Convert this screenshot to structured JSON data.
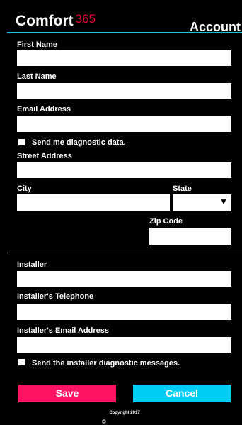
{
  "header": {
    "brand_name": "Comfort",
    "brand_number": "365",
    "title": "Account"
  },
  "fields": {
    "first_name": {
      "label": "First Name",
      "value": ""
    },
    "last_name": {
      "label": "Last Name",
      "value": ""
    },
    "email": {
      "label": "Email Address",
      "value": ""
    },
    "street": {
      "label": "Street Address",
      "value": ""
    },
    "city": {
      "label": "City",
      "value": ""
    },
    "state": {
      "label": "State",
      "value": ""
    },
    "zip": {
      "label": "Zip Code",
      "value": ""
    },
    "installer": {
      "label": "Installer",
      "value": ""
    },
    "installer_phone": {
      "label": "Installer's Telephone",
      "value": ""
    },
    "installer_email": {
      "label": "Installer's Email Address",
      "value": ""
    }
  },
  "checkboxes": {
    "diagnostic_data": {
      "label": "Send me diagnostic data.",
      "checked": false
    },
    "installer_messages": {
      "label": "Send the installer diagnostic messages.",
      "checked": false
    }
  },
  "buttons": {
    "save": "Save",
    "cancel": "Cancel"
  },
  "footer": {
    "copyright": "Copyright 2017",
    "logo_mark": "©"
  },
  "colors": {
    "accent_rule": "#19c2e3",
    "save": "#ff1464",
    "cancel": "#00cdf5",
    "brand_number": "#e8003a"
  }
}
